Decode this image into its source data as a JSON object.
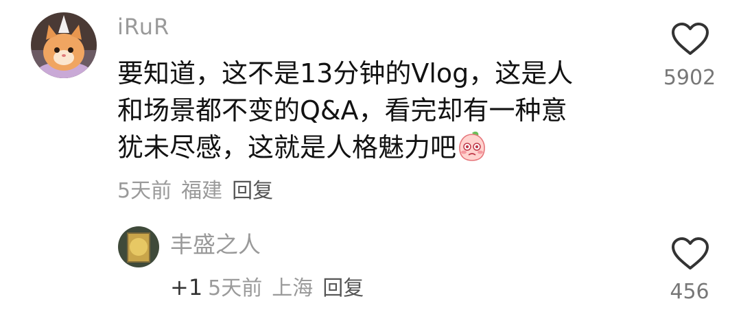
{
  "comment": {
    "username": "iRuR",
    "text_lines": [
      "要知道，这不是13分钟的Vlog，这是人",
      "和场景都不变的Q&A，看完却有一种意",
      "犹未尽感，这就是人格魅力吧"
    ],
    "time": "5天前",
    "location": "福建",
    "reply_label": "回复",
    "like_count": "5902",
    "emoji_icon": "shy-peach-emoji-icon"
  },
  "reply": {
    "username": "丰盛之人",
    "text": "+1",
    "time": "5天前",
    "location": "上海",
    "reply_label": "回复",
    "like_count": "456"
  },
  "colors": {
    "text": "#121212",
    "muted": "#9a9a9a",
    "heart": "#333333"
  }
}
